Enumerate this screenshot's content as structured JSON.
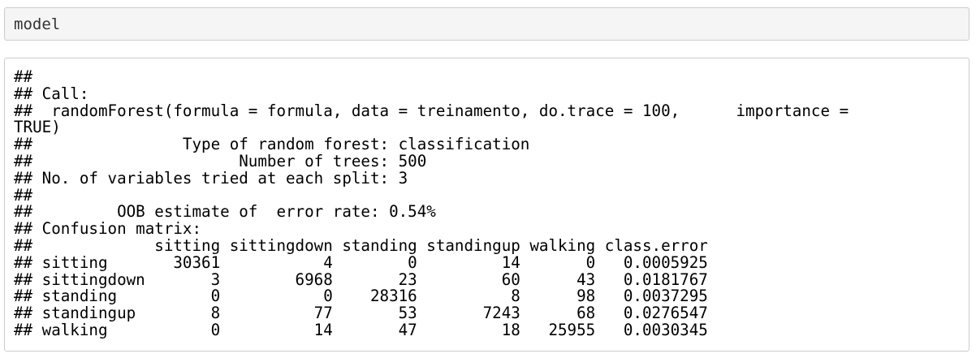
{
  "input": {
    "code": "model"
  },
  "output": {
    "lines": [
      "##",
      "## Call:",
      "##  randomForest(formula = formula, data = treinamento, do.trace = 100,      importance =",
      "TRUE)",
      "##                Type of random forest: classification",
      "##                      Number of trees: 500",
      "## No. of variables tried at each split: 3",
      "##",
      "##         OOB estimate of  error rate: 0.54%",
      "## Confusion matrix:",
      "##             sitting sittingdown standing standingup walking class.error",
      "## sitting       30361           4        0         14       0   0.0005925",
      "## sittingdown       3        6968       23         60      43   0.0181767",
      "## standing          0           0    28316          8      98   0.0037295",
      "## standingup        8          77       53       7243      68   0.0276547",
      "## walking           0          14       47         18   25955   0.0030345"
    ]
  }
}
